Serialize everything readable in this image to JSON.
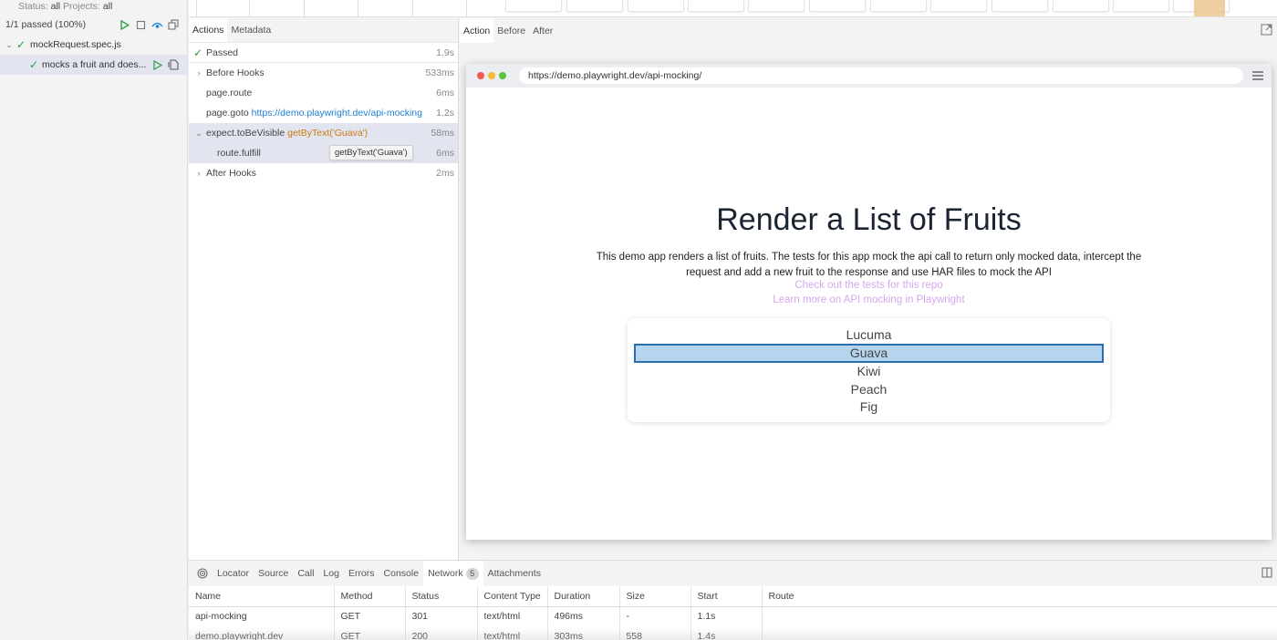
{
  "sidebar": {
    "filter": {
      "status_label": "Status:",
      "status_value": "all",
      "projects_label": "Projects:",
      "projects_value": "all"
    },
    "summary": "1/1 passed (100%)",
    "toolbar": {
      "run": "play-icon",
      "stop": "stop-icon",
      "watch": "eye-icon",
      "collapse": "collapse-all-icon"
    },
    "tree": [
      {
        "label": "mockRequest.spec.js",
        "status": "passed",
        "expanded": true
      },
      {
        "label": "mocks a fruit and does...",
        "status": "passed",
        "selected": true
      }
    ]
  },
  "actions_pane": {
    "tabs": [
      {
        "label": "Actions",
        "active": true
      },
      {
        "label": "Metadata",
        "active": false
      }
    ],
    "status": {
      "label": "Passed",
      "duration": "1.9s"
    },
    "rows": [
      {
        "label": "Before Hooks",
        "duration": "533ms",
        "expandable": true
      },
      {
        "label": "page.route",
        "duration": "6ms"
      },
      {
        "label": "page.goto",
        "arg": "https://demo.playwright.dev/api-mocking",
        "duration": "1.2s"
      },
      {
        "label": "expect.toBeVisible",
        "selector": "getByText('Guava')",
        "duration": "58ms",
        "expanded": true,
        "selected": true
      },
      {
        "label": "route.fulfill",
        "duration": "6ms",
        "tooltip": "getByText('Guava')",
        "selected": true
      },
      {
        "label": "After Hooks",
        "duration": "2ms",
        "expandable": true
      }
    ]
  },
  "snapshot_pane": {
    "tabs": [
      {
        "label": "Action",
        "active": true
      },
      {
        "label": "Before"
      },
      {
        "label": "After"
      }
    ],
    "browser": {
      "url": "https://demo.playwright.dev/api-mocking/",
      "page": {
        "title": "Render a List of Fruits",
        "description": "This demo app renders a list of fruits. The tests for this app mock the api call to return only mocked data, intercept the request and add a new fruit to the response and use HAR files to mock the API",
        "links": [
          "Check out the tests for this repo",
          "Learn more on API mocking in Playwright"
        ],
        "fruits": [
          "Lucuma",
          "Guava",
          "Kiwi",
          "Peach",
          "Fig"
        ],
        "highlighted_fruit": "Guava"
      }
    }
  },
  "bottom_panel": {
    "tabs": [
      {
        "label": "Locator"
      },
      {
        "label": "Source"
      },
      {
        "label": "Call"
      },
      {
        "label": "Log"
      },
      {
        "label": "Errors"
      },
      {
        "label": "Console"
      },
      {
        "label": "Network",
        "badge": "5",
        "active": true
      },
      {
        "label": "Attachments"
      }
    ],
    "network": {
      "columns": [
        "Name",
        "Method",
        "Status",
        "Content Type",
        "Duration",
        "Size",
        "Start",
        "Route"
      ],
      "rows": [
        [
          "api-mocking",
          "GET",
          "301",
          "text/html",
          "496ms",
          "-",
          "1.1s",
          ""
        ],
        [
          "demo.playwright.dev",
          "GET",
          "200",
          "text/html",
          "303ms",
          "558",
          "1.4s",
          ""
        ]
      ]
    }
  },
  "colors": {
    "passed": "#2a9d3d",
    "link": "#1a7fd6",
    "selector": "#c87c0a",
    "highlight_fill": "#b7d4ee",
    "highlight_border": "#2a6eb0",
    "timeline_marker": "#ecc68f",
    "page_link": "#d7a6ee"
  }
}
